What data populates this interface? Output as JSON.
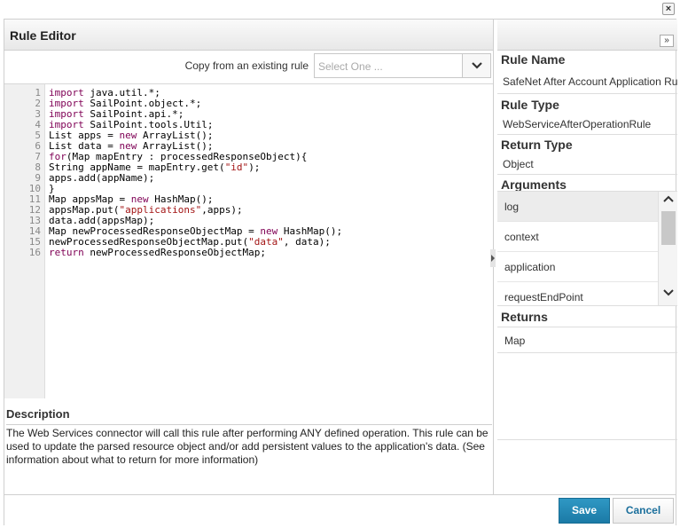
{
  "window": {
    "close_label": "×"
  },
  "editor": {
    "title": "Rule Editor",
    "copy_label": "Copy from an existing rule",
    "copy_placeholder": "Select One ...",
    "lines": [
      [
        {
          "t": "import",
          "c": "kw"
        },
        {
          "t": " java.util.*;"
        }
      ],
      [
        {
          "t": "import",
          "c": "kw"
        },
        {
          "t": " SailPoint.object.*;"
        }
      ],
      [
        {
          "t": "import",
          "c": "kw"
        },
        {
          "t": " SailPoint.api.*;"
        }
      ],
      [
        {
          "t": "import",
          "c": "kw"
        },
        {
          "t": " SailPoint.tools.Util;"
        }
      ],
      [
        {
          "t": "List apps = "
        },
        {
          "t": "new",
          "c": "kw"
        },
        {
          "t": " ArrayList();"
        }
      ],
      [
        {
          "t": "List data = "
        },
        {
          "t": "new",
          "c": "kw"
        },
        {
          "t": " ArrayList();"
        }
      ],
      [
        {
          "t": "for",
          "c": "kw"
        },
        {
          "t": "(Map mapEntry : processedResponseObject){"
        }
      ],
      [
        {
          "t": "String appName = mapEntry.get("
        },
        {
          "t": "\"id\"",
          "c": "str"
        },
        {
          "t": ");"
        }
      ],
      [
        {
          "t": "apps.add(appName);"
        }
      ],
      [
        {
          "t": "}"
        }
      ],
      [
        {
          "t": "Map appsMap = "
        },
        {
          "t": "new",
          "c": "kw"
        },
        {
          "t": " HashMap();"
        }
      ],
      [
        {
          "t": "appsMap.put("
        },
        {
          "t": "\"applications\"",
          "c": "str"
        },
        {
          "t": ",apps);"
        }
      ],
      [
        {
          "t": "data.add(appsMap);"
        }
      ],
      [
        {
          "t": "Map newProcessedResponseObjectMap = "
        },
        {
          "t": "new",
          "c": "kw"
        },
        {
          "t": " HashMap();"
        }
      ],
      [
        {
          "t": "newProcessedResponseObjectMap.put("
        },
        {
          "t": "\"data\"",
          "c": "str"
        },
        {
          "t": ", data);"
        }
      ],
      [
        {
          "t": "return",
          "c": "kw"
        },
        {
          "t": " newProcessedResponseObjectMap;"
        }
      ]
    ]
  },
  "description": {
    "heading": "Description",
    "text": "The Web Services connector will call this rule after performing ANY defined operation. This rule can be used to update the parsed resource object and/or add persistent values to the application's data. (See information about what to return for more information)"
  },
  "details": {
    "expand_label": "»",
    "rule_name_label": "Rule Name",
    "rule_name": "SafeNet After Account Application Rule",
    "rule_type_label": "Rule Type",
    "rule_type": "WebServiceAfterOperationRule",
    "return_type_label": "Return Type",
    "return_type": "Object",
    "arguments_label": "Arguments",
    "arguments": [
      "log",
      "context",
      "application",
      "requestEndPoint"
    ],
    "returns_label": "Returns",
    "returns": "Map"
  },
  "footer": {
    "save_label": "Save",
    "cancel_label": "Cancel"
  },
  "colors": {
    "primary": "#1f86b4",
    "link": "#1b6f9c"
  }
}
